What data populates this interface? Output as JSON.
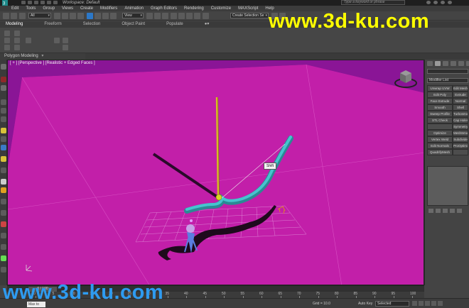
{
  "app": {
    "title": "Workspace: Default",
    "search_placeholder": "Type a keyword or phrase"
  },
  "menu": [
    {
      "label": "Edit"
    },
    {
      "label": "Tools"
    },
    {
      "label": "Group"
    },
    {
      "label": "Views"
    },
    {
      "label": "Create"
    },
    {
      "label": "Modifiers"
    },
    {
      "label": "Animation"
    },
    {
      "label": "Graph Editors"
    },
    {
      "label": "Rendering"
    },
    {
      "label": "Customize"
    },
    {
      "label": "MAXScript"
    },
    {
      "label": "Help"
    }
  ],
  "toolbar": {
    "selection_filter": "All",
    "ref_coord": "View",
    "named_selection": "Create Selection Se"
  },
  "ribbon": {
    "tabs": [
      {
        "label": "Modeling",
        "active": true
      },
      {
        "label": "Freeform",
        "active": false
      },
      {
        "label": "Selection",
        "active": false
      },
      {
        "label": "Object Paint",
        "active": false
      },
      {
        "label": "Populate",
        "active": false
      }
    ],
    "panel_label": "Polygon Modeling"
  },
  "viewport": {
    "label": "[ + ] [Perspective ] [Realistic + Edged Faces ]",
    "tooltip": "Shift",
    "background_color": "#8a1596",
    "ground_color": "#c21fa9"
  },
  "command_panel": {
    "modifier_list_label": "Modifier List",
    "modifiers": [
      "Unwrap UVW",
      "Edit Mesh",
      "Edit Poly",
      "Extrude",
      "Face Extrude",
      "Normal",
      "Smooth",
      "Shell",
      "Sweep Profile",
      "Turbosmooth",
      "STL Check",
      "Cap Holes",
      "",
      "Symmetry",
      "Optimize",
      "MeshSmooth",
      "Vertex Weld",
      "Subdivide",
      "Edit Normals",
      "ProOptimizer",
      "QuadrifyMesh",
      ""
    ]
  },
  "timeline": {
    "slider": "0 / 100",
    "ticks": [
      "0",
      "5",
      "10",
      "15",
      "20",
      "25",
      "30",
      "35",
      "40",
      "45",
      "50",
      "55",
      "60",
      "65",
      "70",
      "75",
      "80",
      "85",
      "90",
      "95",
      "100"
    ]
  },
  "status": {
    "script_label": "Max to Physc.",
    "grid": "Grid = 10.0",
    "auto_key": "Auto Key",
    "key_mode": "Selected"
  },
  "watermarks": {
    "top": "www.3d-ku.com",
    "bottom": "www.3d-ku.com"
  }
}
